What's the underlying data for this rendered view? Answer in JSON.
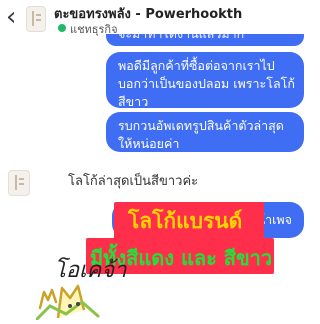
{
  "header": {
    "back_icon": "chevron-left-icon",
    "title": "ตะขอทรงพลัง - Powerhookth",
    "subtitle": "แชทธุรกิจ",
    "status_color": "#1fb866"
  },
  "messages": {
    "partial_top": "จะมาทำได้งานแล้วมาก",
    "outgoing_1": "พอดีมีลูกค้าที่ซื้อต่อจากเราไปบอกว่าเป็นของปลอม เพราะโลโก้สีขาว",
    "outgoing_2": "รบกวนอัพเดทรูปสินค้าตัวล่าสุดให้หน่อยค่า",
    "incoming_1": "โลโก้ล่าสุดเป็นสีขาวค่ะ",
    "outgoing_3_partial": "น้าเพจ"
  },
  "overlay": {
    "label_1": "โลโก้แบรนด์",
    "label_2": "มีทั้งสีแดง และ สีขาว",
    "label_bg_color": "#ff2e4b",
    "label_1_color": "#ffd400",
    "label_2_color": "#22e03a"
  },
  "sticker": {
    "text": "โอเคจ้า",
    "icon": "cat-sticker-icon"
  },
  "colors": {
    "outgoing_bubble": "#3f6ef5"
  }
}
